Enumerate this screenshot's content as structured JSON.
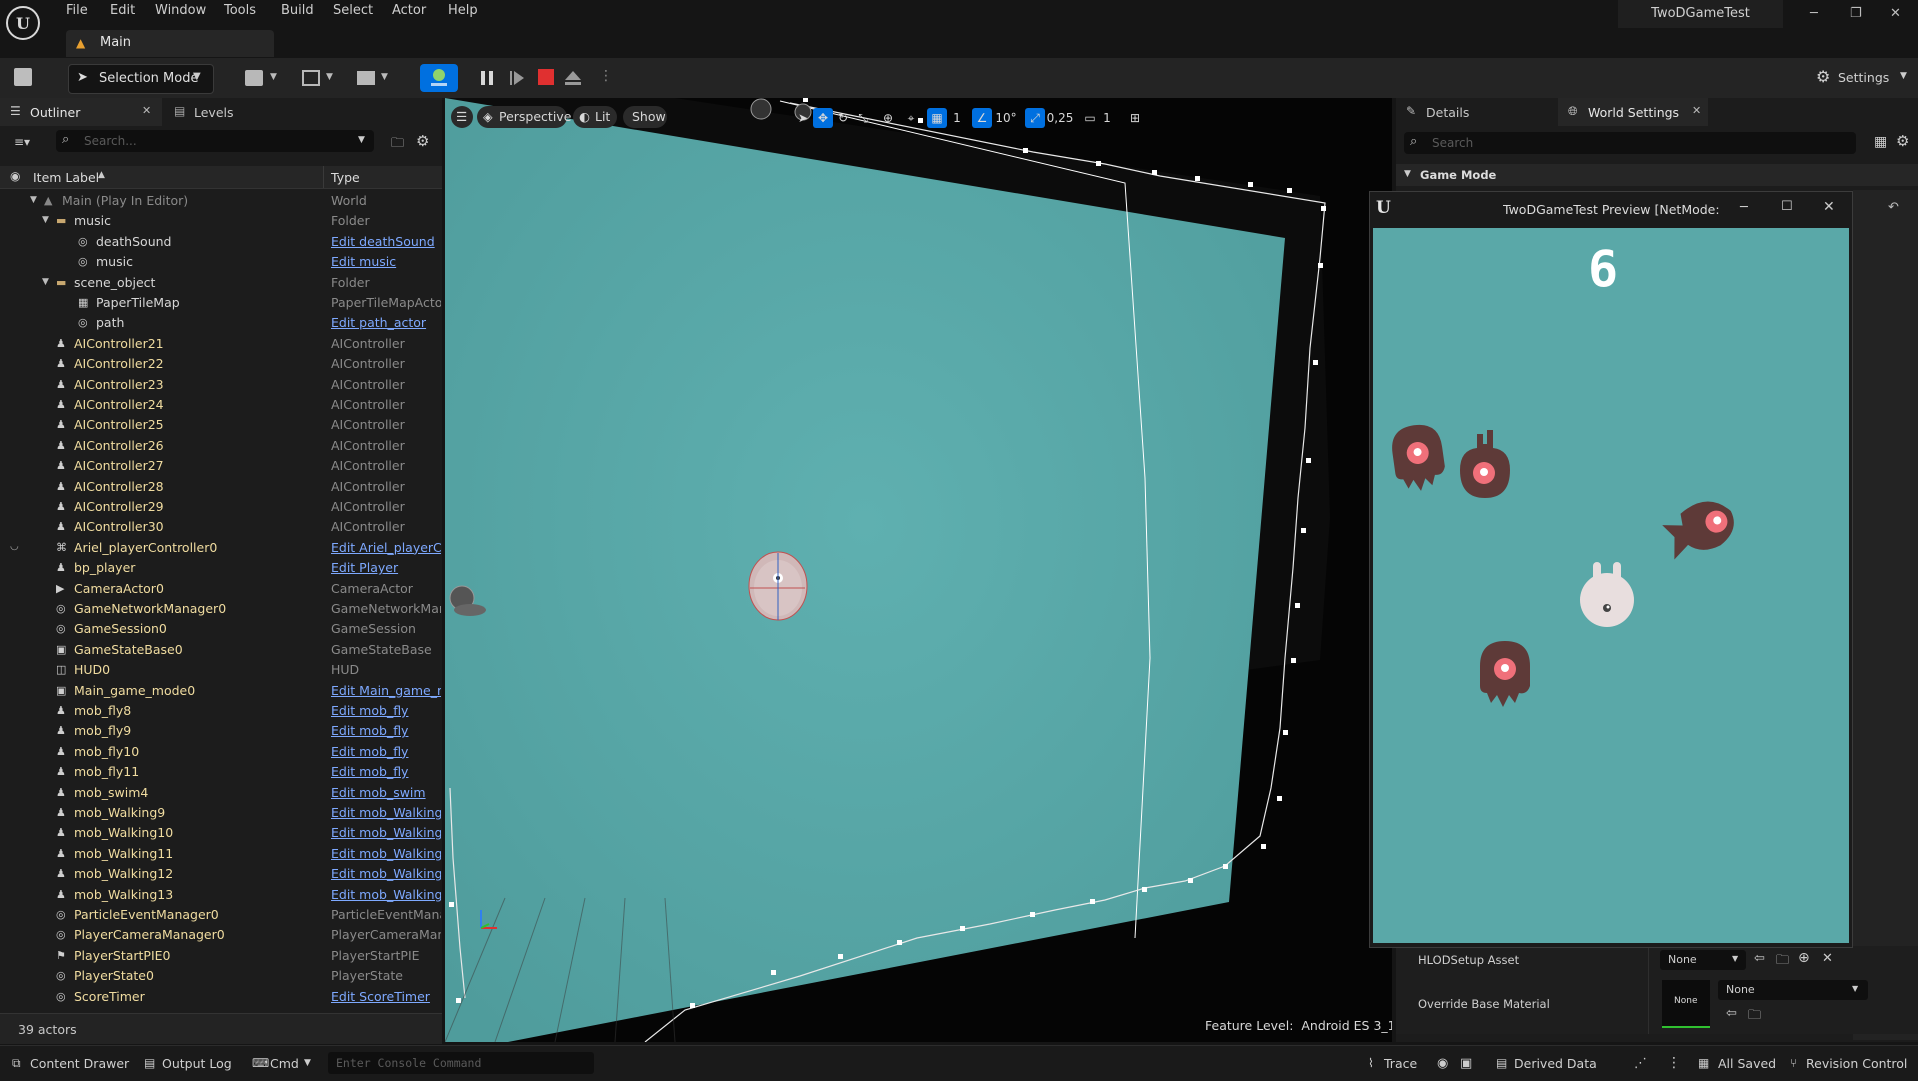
{
  "menu": [
    "File",
    "Edit",
    "Window",
    "Tools",
    "Build",
    "Select",
    "Actor",
    "Help"
  ],
  "project_title": "TwoDGameTest",
  "level_tab": "Main",
  "toolbar": {
    "selection_mode": "Selection Mode",
    "settings": "Settings"
  },
  "outliner": {
    "tab_label": "Outliner",
    "levels_tab": "Levels",
    "search_placeholder": "Search...",
    "col_label": "Item Label",
    "col_type": "Type",
    "actor_count": "39 actors",
    "rows": [
      {
        "name": "Main (Play In Editor)",
        "type": "World",
        "indent": 0,
        "kind": "world",
        "link": false
      },
      {
        "name": "music",
        "type": "Folder",
        "indent": 1,
        "kind": "folder",
        "link": false
      },
      {
        "name": "deathSound",
        "type": "Edit deathSound",
        "indent": 2,
        "kind": "sound",
        "link": true
      },
      {
        "name": "music",
        "type": "Edit music",
        "indent": 2,
        "kind": "sound",
        "link": true
      },
      {
        "name": "scene_object",
        "type": "Folder",
        "indent": 1,
        "kind": "folder",
        "link": false
      },
      {
        "name": "PaperTileMap",
        "type": "PaperTileMapActor",
        "indent": 2,
        "kind": "tilemap",
        "link": false
      },
      {
        "name": "path",
        "type": "Edit path_actor",
        "indent": 2,
        "kind": "sound",
        "link": true
      },
      {
        "name": "AIController21",
        "type": "AIController",
        "indent": 1,
        "kind": "actor",
        "link": false
      },
      {
        "name": "AIController22",
        "type": "AIController",
        "indent": 1,
        "kind": "actor",
        "link": false
      },
      {
        "name": "AIController23",
        "type": "AIController",
        "indent": 1,
        "kind": "actor",
        "link": false
      },
      {
        "name": "AIController24",
        "type": "AIController",
        "indent": 1,
        "kind": "actor",
        "link": false
      },
      {
        "name": "AIController25",
        "type": "AIController",
        "indent": 1,
        "kind": "actor",
        "link": false
      },
      {
        "name": "AIController26",
        "type": "AIController",
        "indent": 1,
        "kind": "actor",
        "link": false
      },
      {
        "name": "AIController27",
        "type": "AIController",
        "indent": 1,
        "kind": "actor",
        "link": false
      },
      {
        "name": "AIController28",
        "type": "AIController",
        "indent": 1,
        "kind": "actor",
        "link": false
      },
      {
        "name": "AIController29",
        "type": "AIController",
        "indent": 1,
        "kind": "actor",
        "link": false
      },
      {
        "name": "AIController30",
        "type": "AIController",
        "indent": 1,
        "kind": "actor",
        "link": false
      },
      {
        "name": "Ariel_playerController0",
        "type": "Edit Ariel_playerCo",
        "indent": 1,
        "kind": "gamepad",
        "link": true
      },
      {
        "name": "bp_player",
        "type": "Edit Player",
        "indent": 1,
        "kind": "actor",
        "link": true
      },
      {
        "name": "CameraActor0",
        "type": "CameraActor",
        "indent": 1,
        "kind": "camera",
        "link": false
      },
      {
        "name": "GameNetworkManager0",
        "type": "GameNetworkMana",
        "indent": 1,
        "kind": "sound",
        "link": false
      },
      {
        "name": "GameSession0",
        "type": "GameSession",
        "indent": 1,
        "kind": "sound",
        "link": false
      },
      {
        "name": "GameStateBase0",
        "type": "GameStateBase",
        "indent": 1,
        "kind": "image",
        "link": false
      },
      {
        "name": "HUD0",
        "type": "HUD",
        "indent": 1,
        "kind": "box",
        "link": false
      },
      {
        "name": "Main_game_mode0",
        "type": "Edit Main_game_m",
        "indent": 1,
        "kind": "image",
        "link": true
      },
      {
        "name": "mob_fly8",
        "type": "Edit mob_fly",
        "indent": 1,
        "kind": "actor",
        "link": true
      },
      {
        "name": "mob_fly9",
        "type": "Edit mob_fly",
        "indent": 1,
        "kind": "actor",
        "link": true
      },
      {
        "name": "mob_fly10",
        "type": "Edit mob_fly",
        "indent": 1,
        "kind": "actor",
        "link": true
      },
      {
        "name": "mob_fly11",
        "type": "Edit mob_fly",
        "indent": 1,
        "kind": "actor",
        "link": true
      },
      {
        "name": "mob_swim4",
        "type": "Edit mob_swim",
        "indent": 1,
        "kind": "actor",
        "link": true
      },
      {
        "name": "mob_Walking9",
        "type": "Edit mob_Walking",
        "indent": 1,
        "kind": "actor",
        "link": true
      },
      {
        "name": "mob_Walking10",
        "type": "Edit mob_Walking",
        "indent": 1,
        "kind": "actor",
        "link": true
      },
      {
        "name": "mob_Walking11",
        "type": "Edit mob_Walking",
        "indent": 1,
        "kind": "actor",
        "link": true
      },
      {
        "name": "mob_Walking12",
        "type": "Edit mob_Walking",
        "indent": 1,
        "kind": "actor",
        "link": true
      },
      {
        "name": "mob_Walking13",
        "type": "Edit mob_Walking",
        "indent": 1,
        "kind": "actor",
        "link": true
      },
      {
        "name": "ParticleEventManager0",
        "type": "ParticleEventManag",
        "indent": 1,
        "kind": "sound",
        "link": false
      },
      {
        "name": "PlayerCameraManager0",
        "type": "PlayerCameraMana",
        "indent": 1,
        "kind": "sound",
        "link": false
      },
      {
        "name": "PlayerStartPIE0",
        "type": "PlayerStartPIE",
        "indent": 1,
        "kind": "flag",
        "link": false
      },
      {
        "name": "PlayerState0",
        "type": "PlayerState",
        "indent": 1,
        "kind": "sound",
        "link": false
      },
      {
        "name": "ScoreTimer",
        "type": "Edit ScoreTimer",
        "indent": 1,
        "kind": "sound",
        "link": true
      }
    ]
  },
  "viewport": {
    "perspective": "Perspective",
    "lit": "Lit",
    "show": "Show",
    "grid_value": "1",
    "angle_value": "10°",
    "scale_value": "0,25",
    "camera_speed": "1",
    "feature_level": "Feature Level:  Android ES 3_1"
  },
  "right_panel": {
    "details_tab": "Details",
    "world_settings_tab": "World Settings",
    "search_placeholder": "Search",
    "section": "Game Mode",
    "hlod_label": "HLODSetup Asset",
    "hlod_value": "None",
    "override_label": "Override Base Material",
    "override_value": "None",
    "thumb_label": "None"
  },
  "preview": {
    "title": "TwoDGameTest Preview [NetMode: S",
    "score": "6"
  },
  "statusbar": {
    "content_drawer": "Content Drawer",
    "output_log": "Output Log",
    "cmd": "Cmd",
    "console_placeholder": "Enter Console Command",
    "trace": "Trace",
    "derived_data": "Derived Data",
    "all_saved": "All Saved",
    "revision_control": "Revision Control"
  },
  "colors": {
    "accent": "#0070e0",
    "water": "#5aa8a8",
    "mob": "#5e3a38",
    "eye": "#f0707a",
    "link": "#7ea9ff",
    "actor_text": "#f0dca0"
  }
}
